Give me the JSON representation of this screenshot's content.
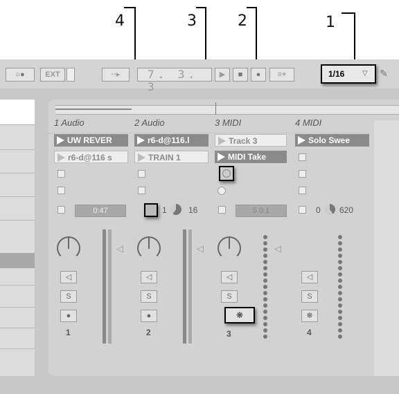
{
  "callouts": [
    "1",
    "2",
    "3",
    "4"
  ],
  "transport": {
    "ext_label": "EXT",
    "position": "7. 3. 3",
    "quantization": "1/16"
  },
  "tracks": [
    {
      "name": "1 Audio",
      "clips": [
        "UW REVER",
        "r6-d@116 s"
      ],
      "clip_count_label": "0:47",
      "number": "1"
    },
    {
      "name": "2 Audio",
      "clips": [
        "r6-d@116.l",
        "TRAIN 1"
      ],
      "info_left": "1",
      "info_right": "16",
      "number": "2"
    },
    {
      "name": "3 MIDI",
      "clips": [
        "Track 3",
        "MIDI Take"
      ],
      "clip_count_label": "5.0.1",
      "number": "3"
    },
    {
      "name": "4 MIDI",
      "clips": [
        "Solo Swee"
      ],
      "info_left": "0",
      "info_right": "620",
      "number": "4"
    }
  ],
  "buttons": {
    "solo_label": "S"
  },
  "colors": {
    "clip_dark": "#8a8a8a",
    "background": "#c8c8c8"
  }
}
